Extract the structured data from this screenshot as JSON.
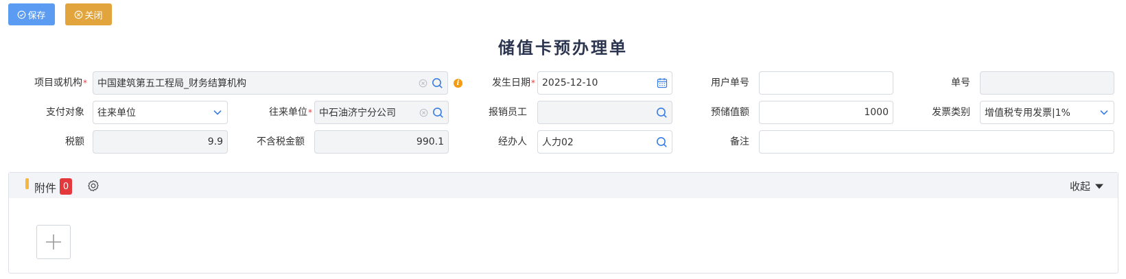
{
  "toolbar": {
    "save_label": "保存",
    "close_label": "关闭"
  },
  "title": "储值卡预办理单",
  "form": {
    "project": {
      "label": "项目或机构",
      "value": "中国建筑第五工程局_财务结算机构",
      "required": "*"
    },
    "occur_date": {
      "label": "发生日期",
      "value": "2025-12-10",
      "required": "*"
    },
    "user_doc_no": {
      "label": "用户单号",
      "value": ""
    },
    "doc_no": {
      "label": "单号",
      "value": ""
    },
    "pay_target": {
      "label": "支付对象",
      "value": "往来单位"
    },
    "counterparty": {
      "label": "往来单位",
      "value": "中石油济宁分公司",
      "required": "*"
    },
    "reimburser": {
      "label": "报销员工",
      "value": ""
    },
    "prestore_amount": {
      "label": "预储值额",
      "value": "1000"
    },
    "invoice_type": {
      "label": "发票类别",
      "value": "增值税专用发票|1%"
    },
    "tax": {
      "label": "税额",
      "value": "9.9"
    },
    "amount_excl_tax": {
      "label": "不含税金额",
      "value": "990.1"
    },
    "handler": {
      "label": "经办人",
      "value": "人力02"
    },
    "remark": {
      "label": "备注",
      "value": ""
    }
  },
  "attachments": {
    "title": "附件",
    "count": "0",
    "collapse_label": "收起"
  },
  "colors": {
    "primary": "#5b9cf2",
    "warning": "#e2a53d",
    "danger": "#e4393c",
    "accent": "#f6b73c",
    "icon_blue": "#3a7de0"
  }
}
